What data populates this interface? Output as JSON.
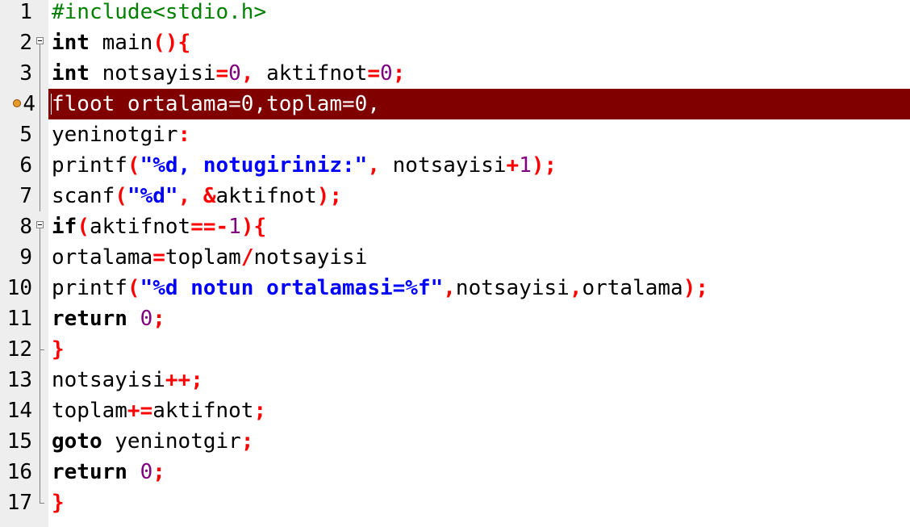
{
  "editor": {
    "colors": {
      "highlight_bg": "#800000",
      "gutter_bg": "#eeeeee",
      "keyword": "#000000",
      "operator": "#ff0000",
      "number": "#800080",
      "string": "#0000ff",
      "preprocessor": "#008000"
    },
    "breakpoint_line": 4,
    "lines": [
      {
        "num": "1",
        "tokens": [
          {
            "t": "pp",
            "v": "#include<stdio.h>"
          }
        ]
      },
      {
        "num": "2",
        "tokens": [
          {
            "t": "kw",
            "v": "int"
          },
          {
            "t": "plain",
            "v": " main"
          },
          {
            "t": "op",
            "v": "(){"
          }
        ]
      },
      {
        "num": "3",
        "tokens": [
          {
            "t": "kw",
            "v": "int"
          },
          {
            "t": "plain",
            "v": " notsayisi"
          },
          {
            "t": "op",
            "v": "="
          },
          {
            "t": "num",
            "v": "0"
          },
          {
            "t": "op",
            "v": ","
          },
          {
            "t": "plain",
            "v": " aktifnot"
          },
          {
            "t": "op",
            "v": "="
          },
          {
            "t": "num",
            "v": "0"
          },
          {
            "t": "op",
            "v": ";"
          }
        ]
      },
      {
        "num": "4",
        "tokens": [
          {
            "t": "plain",
            "v": "floot ortalama=0,toplam=0,"
          }
        ]
      },
      {
        "num": "5",
        "tokens": [
          {
            "t": "plain",
            "v": "yeninotgir"
          },
          {
            "t": "op",
            "v": ":"
          }
        ]
      },
      {
        "num": "6",
        "tokens": [
          {
            "t": "plain",
            "v": "printf"
          },
          {
            "t": "op",
            "v": "("
          },
          {
            "t": "str",
            "v": "\"%d, notugiriniz:\""
          },
          {
            "t": "op",
            "v": ","
          },
          {
            "t": "plain",
            "v": " notsayisi"
          },
          {
            "t": "op",
            "v": "+"
          },
          {
            "t": "num",
            "v": "1"
          },
          {
            "t": "op",
            "v": ");"
          }
        ]
      },
      {
        "num": "7",
        "tokens": [
          {
            "t": "plain",
            "v": "scanf"
          },
          {
            "t": "op",
            "v": "("
          },
          {
            "t": "str",
            "v": "\"%d\""
          },
          {
            "t": "op",
            "v": ","
          },
          {
            "t": "plain",
            "v": " "
          },
          {
            "t": "op",
            "v": "&"
          },
          {
            "t": "plain",
            "v": "aktifnot"
          },
          {
            "t": "op",
            "v": ");"
          }
        ]
      },
      {
        "num": "8",
        "tokens": [
          {
            "t": "kw",
            "v": "if"
          },
          {
            "t": "op",
            "v": "("
          },
          {
            "t": "plain",
            "v": "aktifnot"
          },
          {
            "t": "op",
            "v": "==-"
          },
          {
            "t": "num",
            "v": "1"
          },
          {
            "t": "op",
            "v": "){"
          }
        ]
      },
      {
        "num": "9",
        "tokens": [
          {
            "t": "plain",
            "v": "ortalama"
          },
          {
            "t": "op",
            "v": "="
          },
          {
            "t": "plain",
            "v": "toplam"
          },
          {
            "t": "op",
            "v": "/"
          },
          {
            "t": "plain",
            "v": "notsayisi"
          }
        ]
      },
      {
        "num": "10",
        "tokens": [
          {
            "t": "plain",
            "v": "printf"
          },
          {
            "t": "op",
            "v": "("
          },
          {
            "t": "str",
            "v": "\"%d notun ortalamasi=%f\""
          },
          {
            "t": "op",
            "v": ","
          },
          {
            "t": "plain",
            "v": "notsayisi"
          },
          {
            "t": "op",
            "v": ","
          },
          {
            "t": "plain",
            "v": "ortalama"
          },
          {
            "t": "op",
            "v": ");"
          }
        ]
      },
      {
        "num": "11",
        "tokens": [
          {
            "t": "kw",
            "v": "return"
          },
          {
            "t": "plain",
            "v": " "
          },
          {
            "t": "num",
            "v": "0"
          },
          {
            "t": "op",
            "v": ";"
          }
        ]
      },
      {
        "num": "12",
        "tokens": [
          {
            "t": "op",
            "v": "}"
          }
        ]
      },
      {
        "num": "13",
        "tokens": [
          {
            "t": "plain",
            "v": "notsayisi"
          },
          {
            "t": "op",
            "v": "++;"
          }
        ]
      },
      {
        "num": "14",
        "tokens": [
          {
            "t": "plain",
            "v": "toplam"
          },
          {
            "t": "op",
            "v": "+="
          },
          {
            "t": "plain",
            "v": "aktifnot"
          },
          {
            "t": "op",
            "v": ";"
          }
        ]
      },
      {
        "num": "15",
        "tokens": [
          {
            "t": "kw",
            "v": "goto"
          },
          {
            "t": "plain",
            "v": " yeninotgir"
          },
          {
            "t": "op",
            "v": ";"
          }
        ]
      },
      {
        "num": "16",
        "tokens": [
          {
            "t": "kw",
            "v": "return"
          },
          {
            "t": "plain",
            "v": " "
          },
          {
            "t": "num",
            "v": "0"
          },
          {
            "t": "op",
            "v": ";"
          }
        ]
      },
      {
        "num": "17",
        "tokens": [
          {
            "t": "op",
            "v": "}"
          }
        ]
      }
    ]
  }
}
